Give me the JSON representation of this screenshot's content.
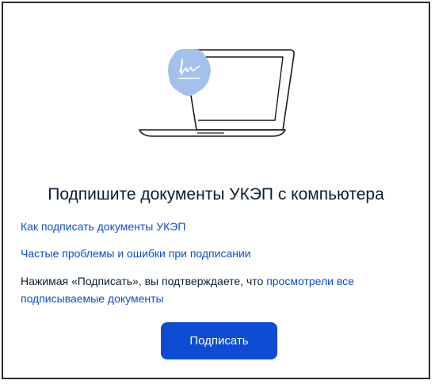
{
  "illustration": {
    "icon": "laptop-with-signature-icon",
    "accent_color": "#a3c1ec"
  },
  "title": "Подпишите документы УКЭП с компьютера",
  "links": {
    "how_to_sign": "Как подписать документы УКЭП",
    "common_problems": "Частые проблемы и ошибки при подписании"
  },
  "notice": {
    "prefix": "Нажимая «Подписать», вы подтверждаете, что ",
    "link_text": "просмотрели все подписываемые документы"
  },
  "sign_button": {
    "label": "Подписать",
    "color": "#0d4cd3"
  }
}
